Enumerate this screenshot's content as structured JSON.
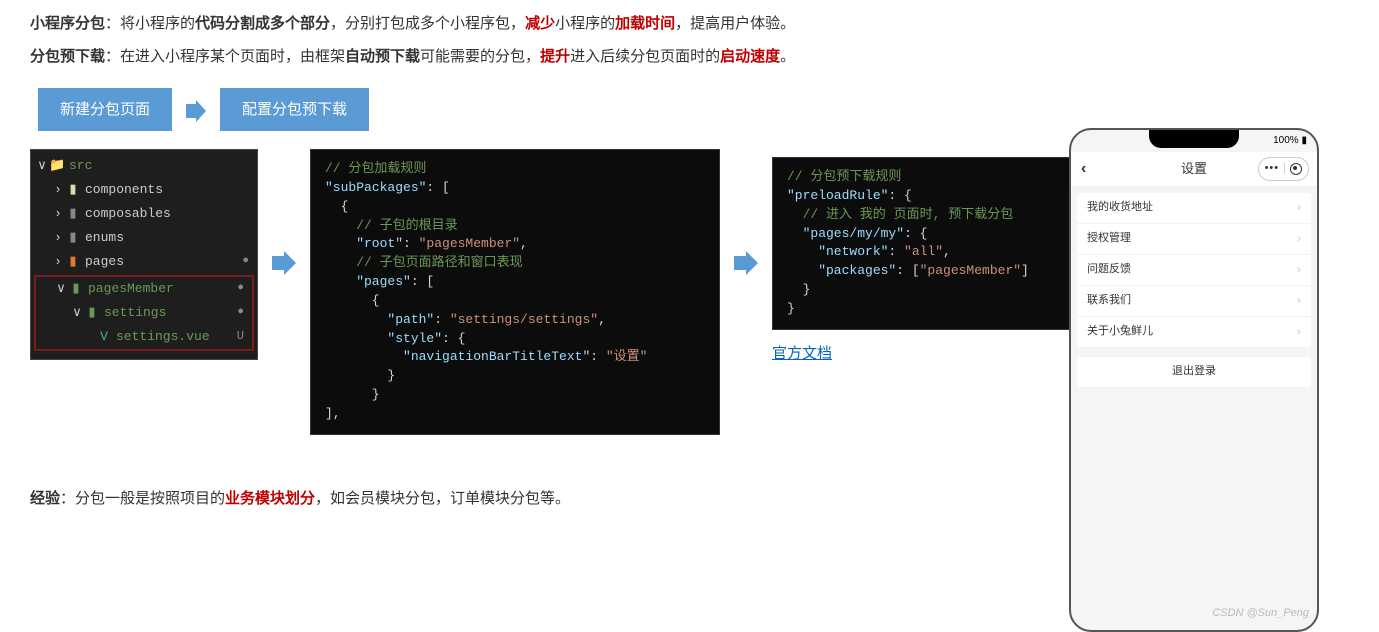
{
  "paragraphs": {
    "p1": {
      "k1": "小程序分包",
      "t1": "：将小程序的",
      "k2": "代码分割成多个部分",
      "t2": "，分别打包成多个小程序包，",
      "r1": "减少",
      "t3": "小程序的",
      "r2": "加载时间",
      "t4": "，提高用户体验。"
    },
    "p2": {
      "k1": "分包预下载",
      "t1": "：在进入小程序某个页面时，由框架",
      "k2": "自动预下载",
      "t2": "可能需要的分包，",
      "r1": "提升",
      "t3": "进入后续分包页面时的",
      "r2": "启动速度",
      "t4": "。"
    },
    "exp": {
      "k1": "经验",
      "t1": "：分包一般是按照项目的",
      "r1": "业务模块划分",
      "t2": "，如会员模块分包，订单模块分包等。"
    }
  },
  "steps": {
    "s1": "新建分包页面",
    "s2": "配置分包预下载"
  },
  "filetree": {
    "src": "src",
    "components": "components",
    "composables": "composables",
    "enums": "enums",
    "pages": "pages",
    "pagesMember": "pagesMember",
    "settings": "settings",
    "settingsVue": "settings.vue",
    "u": "U"
  },
  "code1": {
    "l1": "// 分包加载规则",
    "l2a": "\"subPackages\"",
    "l2b": ": [",
    "l3": "  {",
    "l4": "    // 子包的根目录",
    "l5a": "    \"root\"",
    "l5b": ": ",
    "l5c": "\"pagesMember\"",
    "l5d": ",",
    "l6": "    // 子包页面路径和窗口表现",
    "l7a": "    \"pages\"",
    "l7b": ": [",
    "l8": "      {",
    "l9a": "        \"path\"",
    "l9b": ": ",
    "l9c": "\"settings/settings\"",
    "l9d": ",",
    "l10a": "        \"style\"",
    "l10b": ": {",
    "l11a": "          \"navigationBarTitleText\"",
    "l11b": ": ",
    "l11c": "\"设置\"",
    "l12": "        }",
    "l13": "      }",
    "l14": "],"
  },
  "code2": {
    "l1": "// 分包预下载规则",
    "l2a": "\"preloadRule\"",
    "l2b": ": {",
    "l3": "  // 进入 我的 页面时, 预下载分包",
    "l4a": "  \"pages/my/my\"",
    "l4b": ": {",
    "l5a": "    \"network\"",
    "l5b": ": ",
    "l5c": "\"all\"",
    "l5d": ",",
    "l6a": "    \"packages\"",
    "l6b": ": [",
    "l6c": "\"pagesMember\"",
    "l6d": "]",
    "l7": "  }",
    "l8": "}"
  },
  "link": {
    "official": "官方文档"
  },
  "phone": {
    "status": "100%",
    "title": "设置",
    "items": [
      "我的收货地址",
      "授权管理",
      "问题反馈",
      "联系我们",
      "关于小兔鲜儿"
    ],
    "logout": "退出登录"
  },
  "watermark": "CSDN @Sun_Peng"
}
